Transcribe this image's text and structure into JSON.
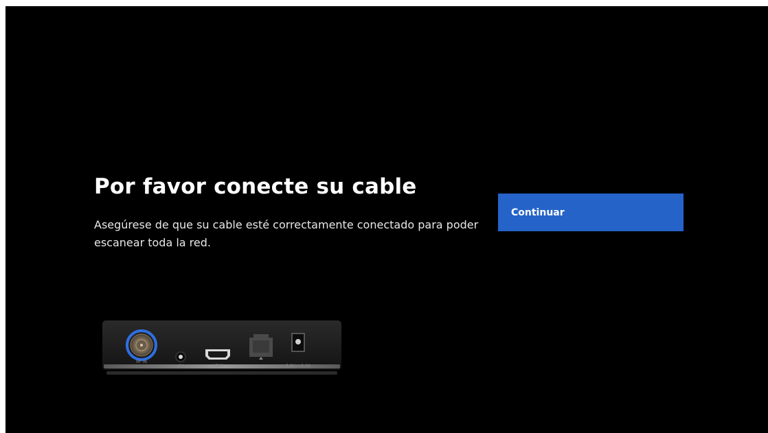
{
  "setup": {
    "title": "Por favor conecte su cable",
    "description": "Asegúrese de que su cable esté correctamente conectado para poder escanear toda la red.",
    "continue_label": "Continuar"
  },
  "device": {
    "ports": [
      "RF IN",
      "AV",
      "HDMI",
      "5.0V ⎓ 2.0A"
    ]
  },
  "colors": {
    "background": "#000000",
    "accent": "#2563c9",
    "highlight_ring": "#2f6fe0"
  }
}
